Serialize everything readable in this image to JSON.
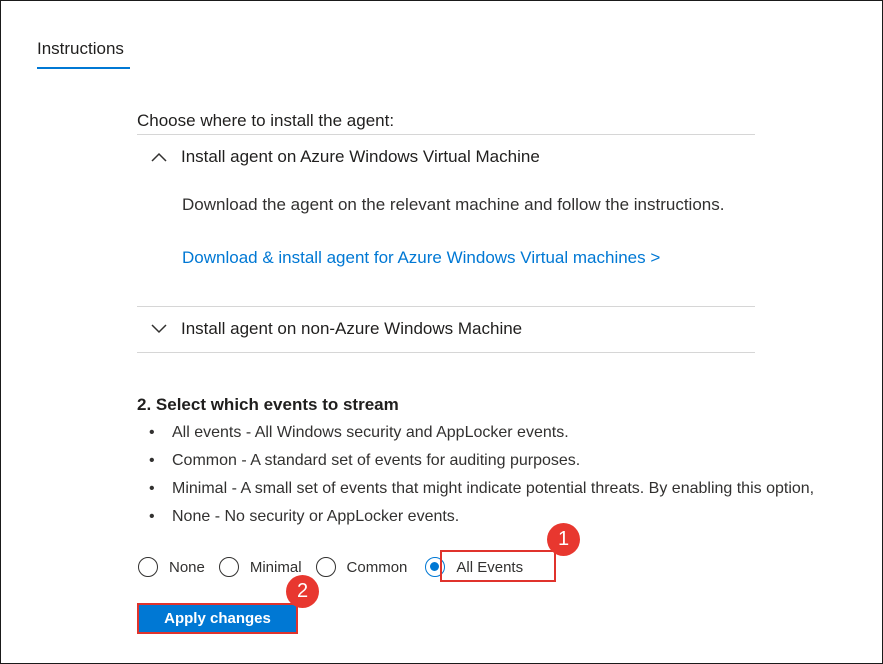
{
  "tab": {
    "label": "Instructions"
  },
  "install": {
    "heading": "Choose where to install the agent:",
    "azure": {
      "title": "Install agent on Azure Windows Virtual Machine",
      "description": "Download the agent on the relevant machine and follow the instructions.",
      "link": "Download & install agent for Azure Windows Virtual machines >",
      "expanded": true
    },
    "nonazure": {
      "title": "Install agent on non-Azure Windows Machine",
      "expanded": false
    }
  },
  "events": {
    "heading": "2. Select which events to stream",
    "bullets": [
      "All events - All Windows security and AppLocker events.",
      "Common - A standard set of events for auditing purposes.",
      "Minimal - A small set of events that might indicate potential threats. By enabling this option,",
      "None - No security or AppLocker events."
    ],
    "options": [
      "None",
      "Minimal",
      "Common",
      "All Events"
    ],
    "selected": "All Events"
  },
  "apply": {
    "label": "Apply changes"
  },
  "callouts": {
    "one": "1",
    "two": "2"
  },
  "colors": {
    "accent": "#0078d4",
    "callout": "#e8372f",
    "highlight": "#e0332c"
  }
}
